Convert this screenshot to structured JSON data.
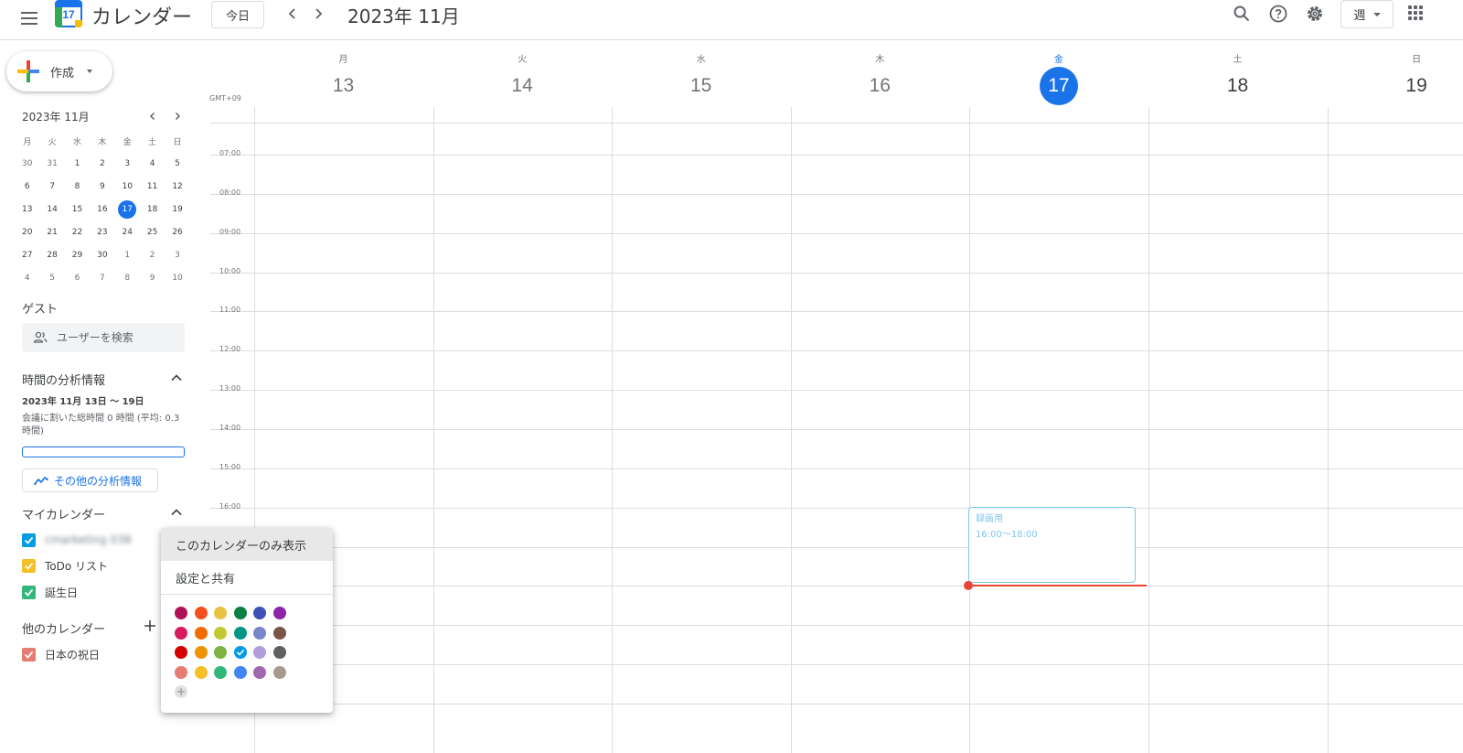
{
  "header": {
    "app_title": "カレンダー",
    "logo_day": "17",
    "today_label": "今日",
    "current_month": "2023年 11月",
    "view_label": "週"
  },
  "create": {
    "label": "作成"
  },
  "mini_calendar": {
    "title": "2023年 11月",
    "weekdays": [
      "月",
      "火",
      "水",
      "木",
      "金",
      "土",
      "日"
    ],
    "weeks": [
      [
        "30",
        "31",
        "1",
        "2",
        "3",
        "4",
        "5"
      ],
      [
        "6",
        "7",
        "8",
        "9",
        "10",
        "11",
        "12"
      ],
      [
        "13",
        "14",
        "15",
        "16",
        "17",
        "18",
        "19"
      ],
      [
        "20",
        "21",
        "22",
        "23",
        "24",
        "25",
        "26"
      ],
      [
        "27",
        "28",
        "29",
        "30",
        "1",
        "2",
        "3"
      ],
      [
        "4",
        "5",
        "6",
        "7",
        "8",
        "9",
        "10"
      ]
    ],
    "today": "17"
  },
  "guests": {
    "title": "ゲスト",
    "search_placeholder": "ユーザーを検索"
  },
  "time_insights": {
    "title": "時間の分析情報",
    "range": "2023年 11月 13日 〜 19日",
    "summary": "会議に割いた総時間 0 時間 (平均: 0.3 時間)",
    "more_button": "その他の分析情報"
  },
  "my_calendars": {
    "title": "マイカレンダー",
    "items": [
      {
        "label": "cmarketing 038",
        "color": "#039be5"
      },
      {
        "label": "ToDo リスト",
        "color": "#f6bf26"
      },
      {
        "label": "誕生日",
        "color": "#33b679"
      }
    ]
  },
  "other_calendars": {
    "title": "他のカレンダー",
    "items": [
      {
        "label": "日本の祝日",
        "color": "#e67c73"
      }
    ]
  },
  "week": {
    "timezone": "GMT+09",
    "days": [
      {
        "dow": "月",
        "date": "13"
      },
      {
        "dow": "火",
        "date": "14"
      },
      {
        "dow": "水",
        "date": "15"
      },
      {
        "dow": "木",
        "date": "16"
      },
      {
        "dow": "金",
        "date": "17"
      },
      {
        "dow": "土",
        "date": "18"
      },
      {
        "dow": "日",
        "date": "19"
      }
    ],
    "hours": [
      "07:00",
      "08:00",
      "09:00",
      "10:00",
      "11:00",
      "12:00",
      "13:00",
      "14:00",
      "15:00",
      "16:00"
    ]
  },
  "event": {
    "title": "録画用",
    "time": "16:00〜18:00",
    "color": "#7cc6ec"
  },
  "context_menu": {
    "show_only": "このカレンダーのみ表示",
    "settings": "設定と共有",
    "swatches": [
      "#ad1457",
      "#f4511e",
      "#e4c441",
      "#0b8043",
      "#3f51b5",
      "#8e24aa",
      "#d81b60",
      "#ef6c00",
      "#c0ca33",
      "#009688",
      "#7986cb",
      "#795548",
      "#d50000",
      "#f09300",
      "#7cb342",
      "#039be5",
      "#b39ddb",
      "#616161",
      "#e67c73",
      "#f6bf26",
      "#33b679",
      "#4285f4",
      "#9e69af",
      "#a79b8e"
    ],
    "selected_swatch": 15
  },
  "colors": {
    "accent": "#1a73e8",
    "now_indicator": "#ea4335"
  }
}
